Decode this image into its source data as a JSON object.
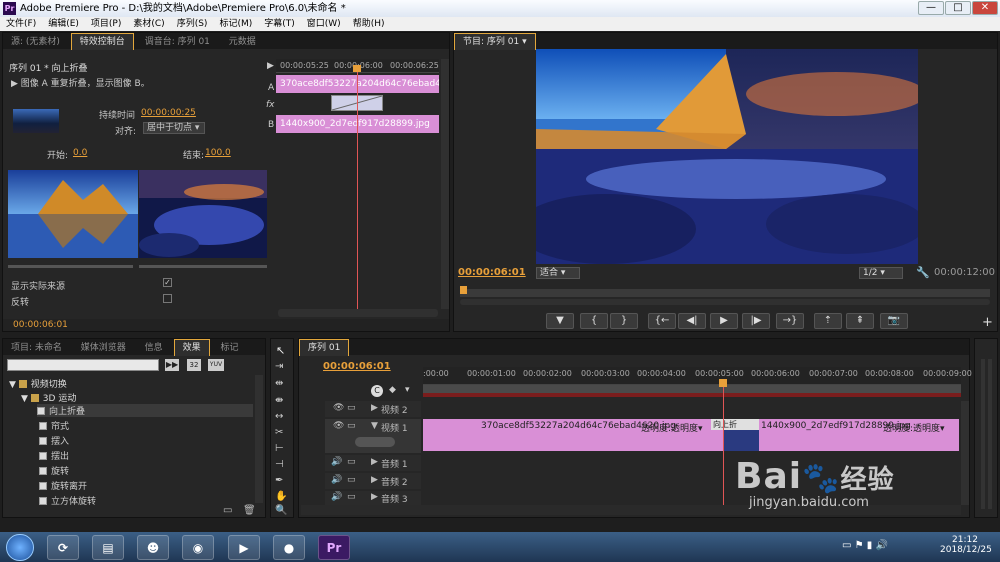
{
  "window": {
    "title": "Adobe Premiere Pro - D:\\我的文档\\Adobe\\Premiere Pro\\6.0\\未命名 *",
    "min": "—",
    "max": "□",
    "close": "✕"
  },
  "menu": [
    "文件(F)",
    "编辑(E)",
    "项目(P)",
    "素材(C)",
    "序列(S)",
    "标记(M)",
    "字幕(T)",
    "窗口(W)",
    "帮助(H)"
  ],
  "source_panel": {
    "tabs": [
      "源: (无素材)",
      "特效控制台",
      "调音台: 序列 01",
      "元数据"
    ],
    "header": "序列 01 * 向上折叠",
    "clip_info": "图像 A 重复折叠，显示图像 B。",
    "duration_label": "持续时间",
    "duration_value": "00:00:00:25",
    "align_label": "对齐:",
    "align_value": "居中于切点",
    "start_label": "开始:",
    "start_value": "0.0",
    "end_label": "结束:",
    "end_value": "100.0",
    "show_source_label": "显示实际来源",
    "reverse_label": "反转",
    "timecode": "00:00:06:01",
    "ruler": [
      "00:00:05:25",
      "00:00:06:00",
      "00:00:06:25"
    ],
    "clip_a": "370ace8df53227a204d64c76ebad4620.jpg",
    "clip_b": "1440x900_2d7edf917d28899.jpg",
    "track_a": "A",
    "track_b": "B",
    "fx": "fx"
  },
  "program_panel": {
    "tab": "节目: 序列 01",
    "current_time": "00:00:06:01",
    "fit": "适合",
    "ratio": "1/2",
    "duration": "00:00:12:00"
  },
  "project_panel": {
    "tabs": [
      "项目: 未命名",
      "媒体浏览器",
      "信息",
      "效果",
      "标记"
    ],
    "search_placeholder": "",
    "badges": [
      "32",
      "YUV"
    ],
    "tree_root": "视频切换",
    "tree_folder": "3D 运动",
    "items": [
      "向上折叠",
      "帘式",
      "摆入",
      "摆出",
      "旋转",
      "旋转离开",
      "立方体旋转"
    ]
  },
  "timeline": {
    "tab": "序列 01",
    "timecode": "00:00:06:01",
    "ruler": [
      ":00:00",
      "00:00:01:00",
      "00:00:02:00",
      "00:00:03:00",
      "00:00:04:00",
      "00:00:05:00",
      "00:00:06:00",
      "00:00:07:00",
      "00:00:08:00",
      "00:00:09:00",
      "00:00"
    ],
    "tracks": [
      "视频 2",
      "视频 1",
      "音频 1",
      "音频 2",
      "音频 3"
    ],
    "clip1": "370ace8df53227a204d64c76ebad4620.jpg",
    "clip1_fx": "透明度:透明度▾",
    "transition": "向上折",
    "clip2": "1440x900_2d7edf917d28899.jpg",
    "clip2_fx": "透明度:透明度▾"
  },
  "taskbar": {
    "time": "21:12",
    "date": "2018/12/25",
    "pr": "Pr"
  },
  "watermark": {
    "brand": "Bai",
    "suffix": "经验",
    "url": "jingyan.baidu.com"
  },
  "colors": {
    "accent": "#e8a03a",
    "clip": "#d98fd6",
    "playhead": "#e05555"
  }
}
